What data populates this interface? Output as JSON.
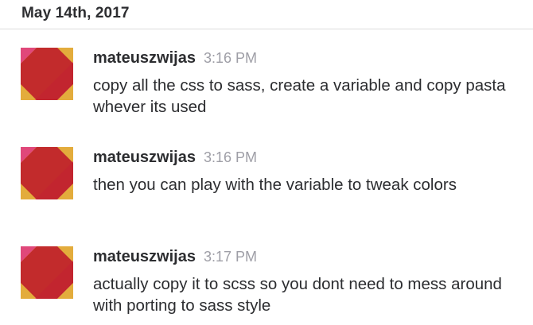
{
  "day_header": {
    "label": "May 14th, 2017"
  },
  "messages": [
    {
      "sender": "mateuszwijas",
      "time": "3:16 PM",
      "text": "copy all the css to sass, create a variable and copy pasta whever its used",
      "avatar_icon": "abstract-tile-avatar"
    },
    {
      "sender": "mateuszwijas",
      "time": "3:16 PM",
      "text": "then you can play with the variable to tweak colors",
      "avatar_icon": "abstract-tile-avatar"
    },
    {
      "sender": "mateuszwijas",
      "time": "3:17 PM",
      "text": "actually copy it to scss so you dont need to mess around with porting to sass style",
      "avatar_icon": "abstract-tile-avatar"
    }
  ],
  "colors": {
    "avatar_yellow": "#e3ac3c",
    "avatar_pink": "#e0487a",
    "avatar_red": "#c0242b",
    "timestamp": "#9e9ea6",
    "text": "#2c2d30"
  }
}
